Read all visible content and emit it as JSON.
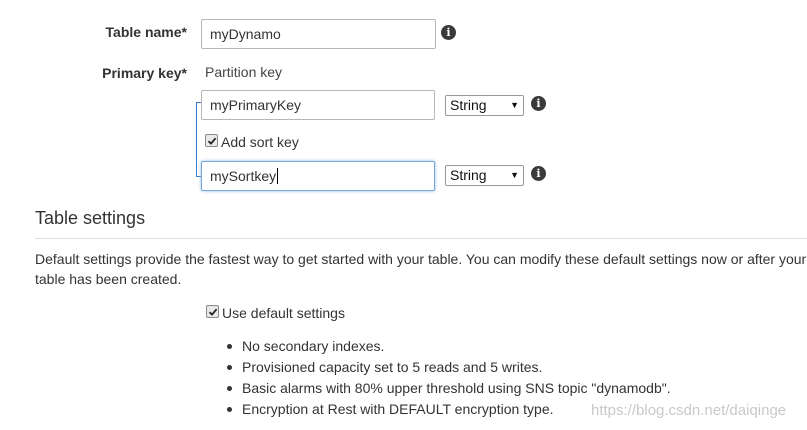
{
  "table_name": {
    "label": "Table name",
    "required_mark": "*",
    "value": "myDynamo"
  },
  "primary_key": {
    "label": "Primary key",
    "required_mark": "*",
    "partition_key_label": "Partition key",
    "partition_key_value": "myPrimaryKey",
    "partition_key_type": "String",
    "add_sort_key_label": "Add sort key",
    "add_sort_key_checked": true,
    "sort_key_value": "mySortkey",
    "sort_key_type": "String"
  },
  "table_settings": {
    "title": "Table settings",
    "description": "Default settings provide the fastest way to get started with your table. You can modify these default settings now or after your table has been created.",
    "use_default_label": "Use default settings",
    "use_default_checked": true,
    "bullets": [
      "No secondary indexes.",
      "Provisioned capacity set to 5 reads and 5 writes.",
      "Basic alarms with 80% upper threshold using SNS topic \"dynamodb\".",
      "Encryption at Rest with DEFAULT encryption type."
    ]
  },
  "watermark": "https://blog.csdn.net/daiqinge",
  "icons": {
    "info": "info-circle-icon",
    "check": "checkmark-icon",
    "dropdown": "chevron-down-icon"
  },
  "colors": {
    "focus_border": "#7aa7d6",
    "bracket": "#3d7bd0"
  }
}
